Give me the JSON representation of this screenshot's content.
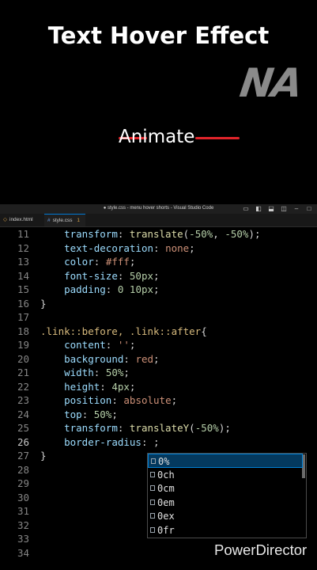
{
  "video": {
    "title": "Text Hover Effect",
    "logo": "NA",
    "demo_text": "Animate",
    "accent_color": "#e0242a",
    "watermark": "PowerDirector"
  },
  "window": {
    "title": "● style.css - menu hover shorts - Visual Studio Code",
    "icons": [
      "layout-icon",
      "sidebar-icon",
      "panel-icon",
      "split-icon",
      "minimize-icon",
      "maximize-icon"
    ]
  },
  "tabs": [
    {
      "label": "index.html",
      "icon": "html-file-icon"
    },
    {
      "label": "style.css",
      "badge": "1",
      "icon": "css-file-icon"
    }
  ],
  "code_lines": [
    {
      "n": "11",
      "text": "    transform: translate(-50%, -50%);"
    },
    {
      "n": "12",
      "text": "    text-decoration: none;"
    },
    {
      "n": "13",
      "text": "    color: #fff;"
    },
    {
      "n": "14",
      "text": "    font-size: 50px;"
    },
    {
      "n": "15",
      "text": "    padding: 0 10px;"
    },
    {
      "n": "16",
      "text": "}"
    },
    {
      "n": "17",
      "text": ""
    },
    {
      "n": "18",
      "text": ".link::before, .link::after{"
    },
    {
      "n": "19",
      "text": "    content: '';"
    },
    {
      "n": "20",
      "text": "    background: red;"
    },
    {
      "n": "21",
      "text": "    width: 50%;"
    },
    {
      "n": "22",
      "text": "    height: 4px;"
    },
    {
      "n": "23",
      "text": "    position: absolute;"
    },
    {
      "n": "24",
      "text": "    top: 50%;"
    },
    {
      "n": "25",
      "text": "    transform: translateY(-50%);"
    },
    {
      "n": "26",
      "text": "    border-radius: ;"
    },
    {
      "n": "27",
      "text": "}"
    },
    {
      "n": "28",
      "text": ""
    },
    {
      "n": "29",
      "text": ""
    },
    {
      "n": "30",
      "text": ""
    },
    {
      "n": "31",
      "text": ""
    },
    {
      "n": "32",
      "text": ""
    },
    {
      "n": "33",
      "text": ""
    },
    {
      "n": "34",
      "text": ""
    }
  ],
  "active_line": "26",
  "suggestions": [
    "0%",
    "0ch",
    "0cm",
    "0em",
    "0ex",
    "0fr"
  ]
}
